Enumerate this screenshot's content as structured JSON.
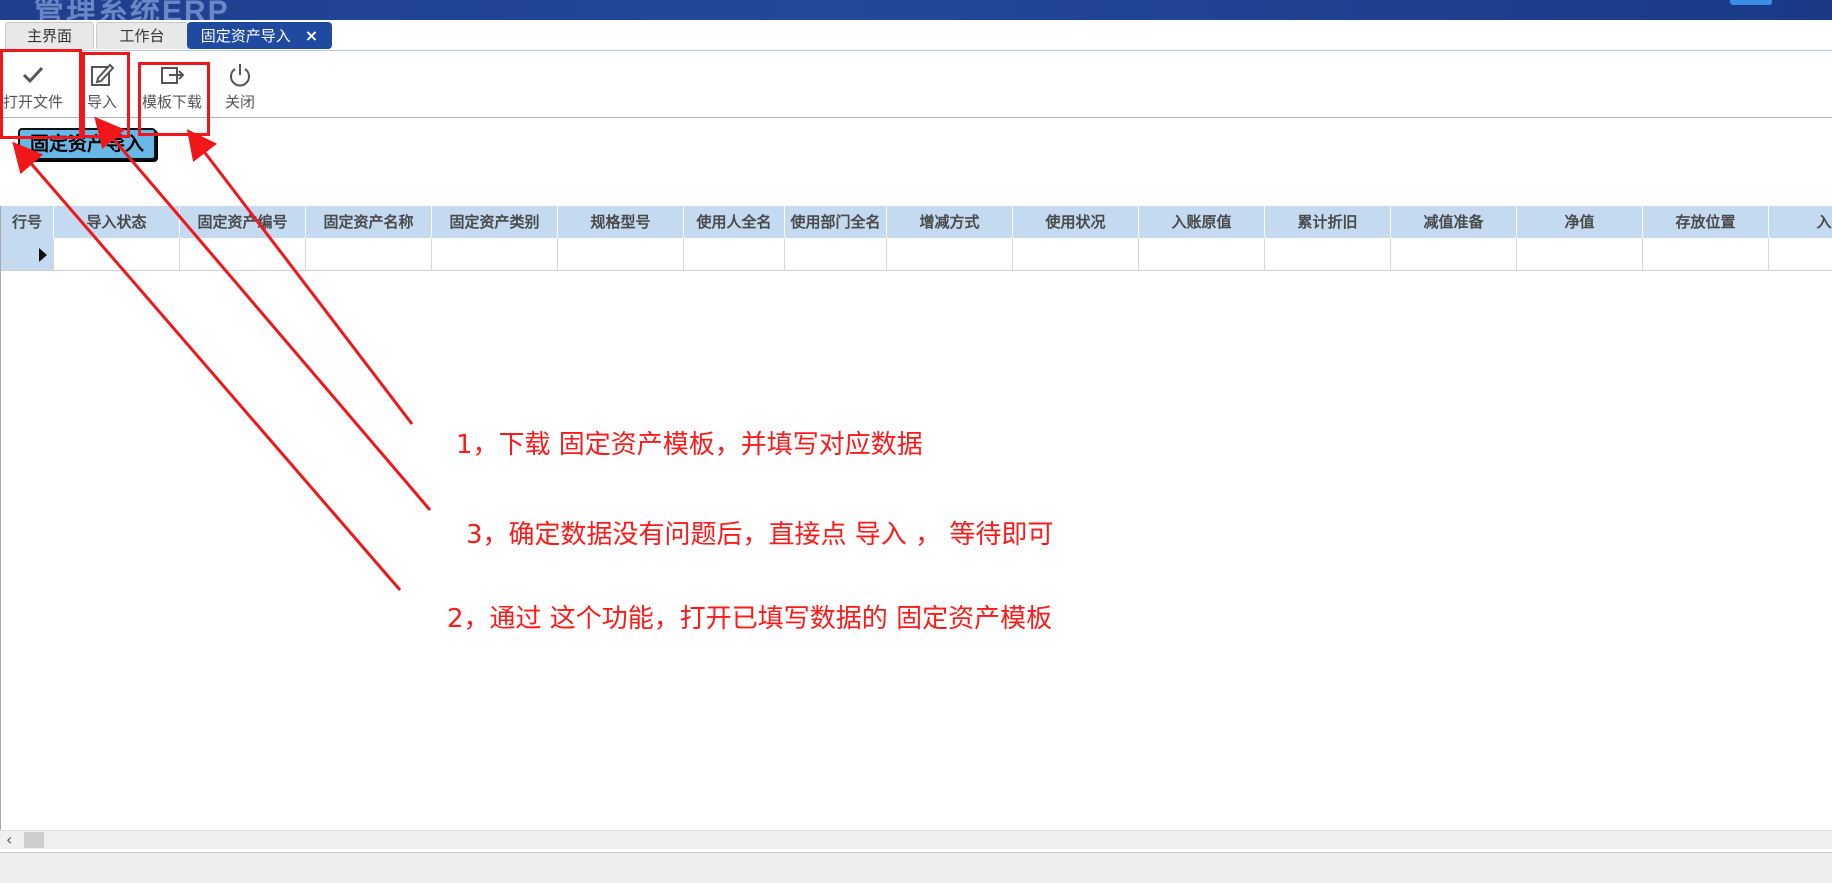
{
  "window": {
    "title_fragment": "管理系统ERP"
  },
  "tabs": [
    {
      "label": "主界面"
    },
    {
      "label": "工作台"
    },
    {
      "label": "固定资产导入",
      "close": "×"
    }
  ],
  "toolbar": {
    "open_file": "打开文件",
    "import": "导入",
    "template_download": "模板下载",
    "close": "关闭"
  },
  "group_label": "固定资产导入",
  "grid": {
    "columns": [
      "行号",
      "导入状态",
      "固定资产编号",
      "固定资产名称",
      "固定资产类别",
      "规格型号",
      "使用人全名",
      "使用部门全名",
      "增减方式",
      "使用状况",
      "入账原值",
      "累计折旧",
      "减值准备",
      "净值",
      "存放位置",
      "入账"
    ]
  },
  "annotations": {
    "step1": "1，下载 固定资产模板，并填写对应数据",
    "step3": "3，确定数据没有问题后，直接点 导入 ， 等待即可",
    "step2": "2，通过 这个功能，打开已填写数据的 固定资产模板"
  },
  "colors": {
    "annotation": "#ff1a1a",
    "header_bg": "#c3daf0",
    "active_tab": "#1f4aa0",
    "group_label_bg": "#69b7e7"
  },
  "icons": {
    "open_file": "checkmark-icon",
    "import": "edit-icon",
    "template_download": "export-icon",
    "close": "power-icon"
  }
}
